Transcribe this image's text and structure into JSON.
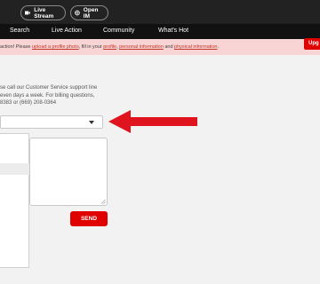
{
  "topbar": {
    "live_stream_label": "Live Stream",
    "open_im_label": "Open IM"
  },
  "nav": {
    "items": [
      {
        "label": "Search"
      },
      {
        "label": "Live Action"
      },
      {
        "label": "Community"
      },
      {
        "label": "What's Hot"
      }
    ]
  },
  "notice": {
    "part1": "action! Please ",
    "link1": "upload a profile photo",
    "part2": ", fill in your ",
    "link2": "profile",
    "part3": ", ",
    "link3": "personal information",
    "part4": " and ",
    "link4": "physical information",
    "part5": ".",
    "upgrade_label": "Upg"
  },
  "support": {
    "text": "se call our Customer Service support line\neven days a week. For billing questions,\n8383 or (669) 208-0364"
  },
  "form": {
    "dropdown_value": "",
    "message_value": "",
    "send_label": "SEND"
  },
  "colors": {
    "accent": "#e00000",
    "arrow": "#e0141e",
    "notice_bg": "#f9d4d4",
    "topbar": "#222222",
    "navbar": "#111111"
  },
  "icons": {
    "live_stream": "camera-icon",
    "open_im": "globe-icon",
    "dropdown": "caret-down-icon",
    "annotation": "red-arrow-icon",
    "textarea": "resize-handle-icon"
  }
}
